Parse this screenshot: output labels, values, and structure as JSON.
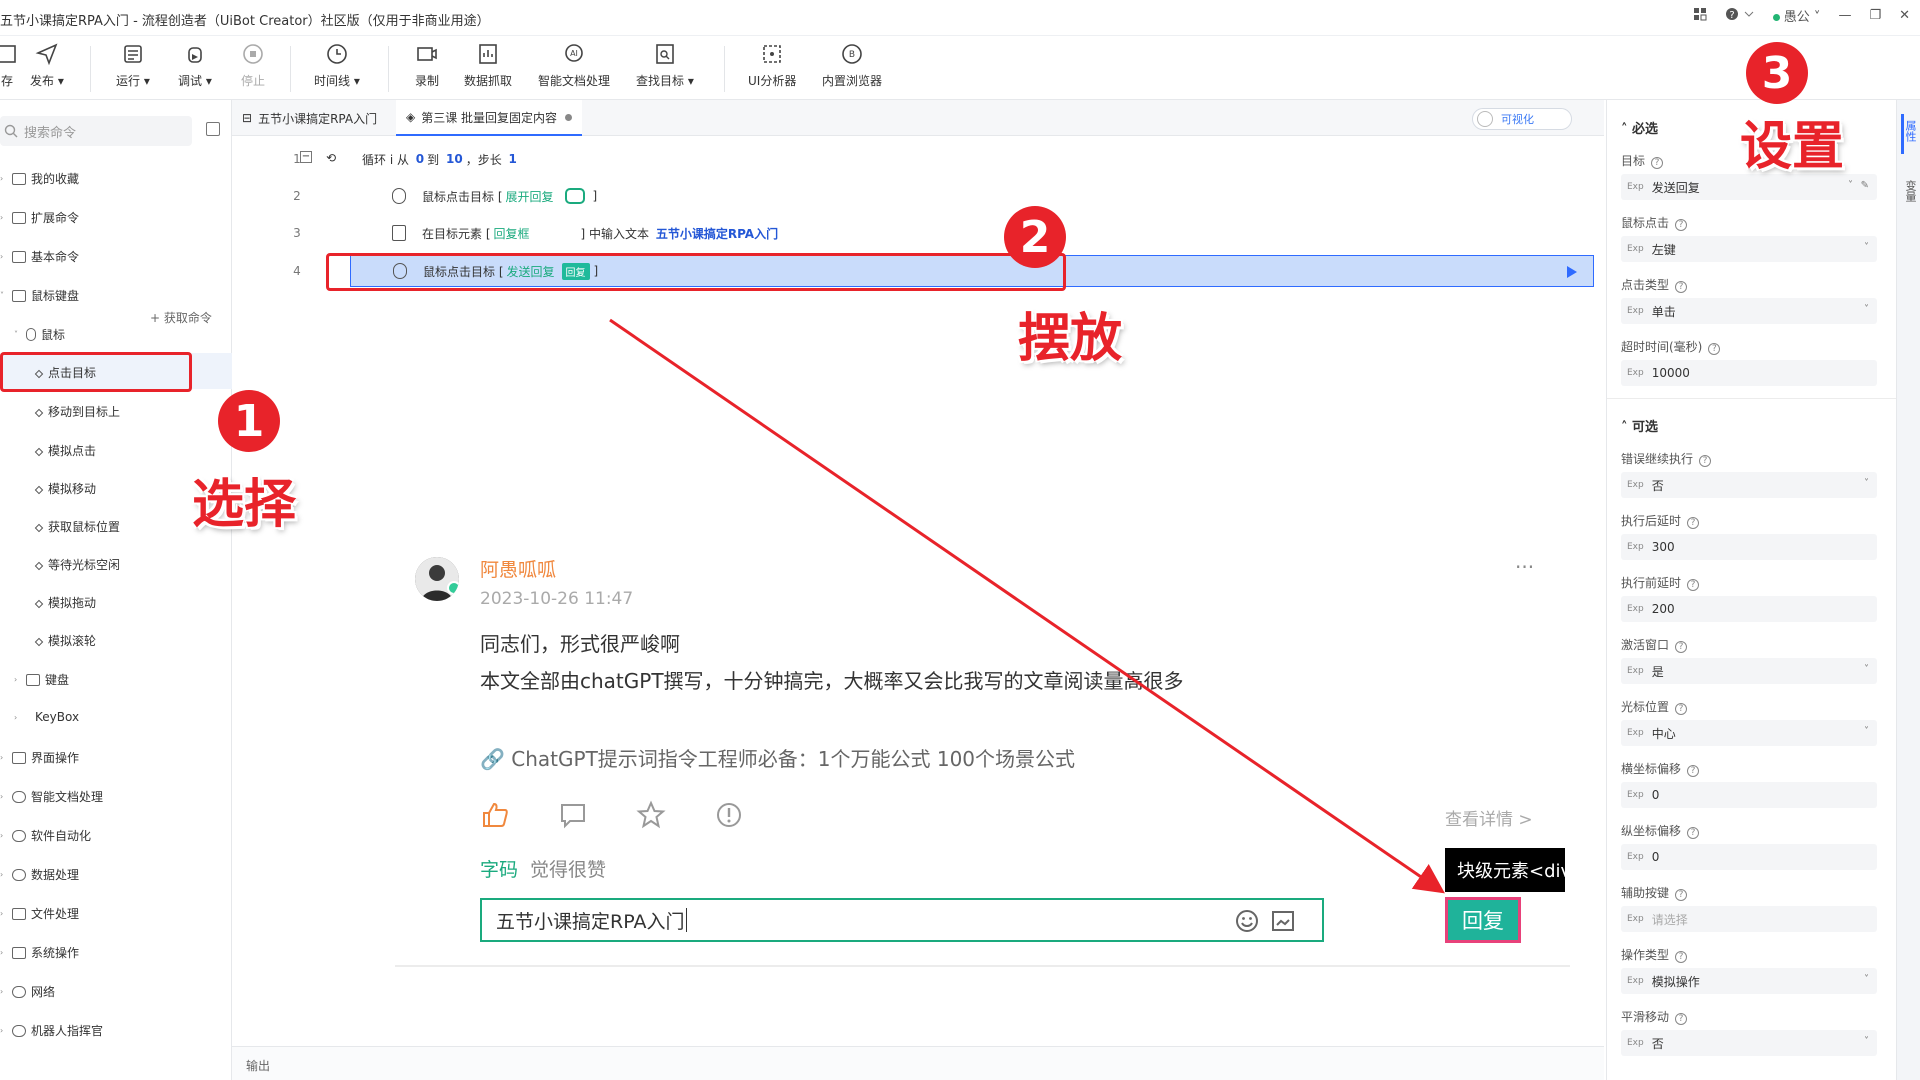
{
  "window": {
    "title": "五节小课搞定RPA入门 - 流程创造者（UiBot Creator）社区版（仅用于非商业用途）",
    "user": "愚公"
  },
  "toolbar": {
    "items": [
      {
        "label": "存"
      },
      {
        "label": "发布 ▾"
      },
      {
        "label": "运行 ▾"
      },
      {
        "label": "调试 ▾"
      },
      {
        "label": "停止"
      },
      {
        "label": "时间线 ▾"
      },
      {
        "label": "录制"
      },
      {
        "label": "数据抓取"
      },
      {
        "label": "智能文档处理"
      },
      {
        "label": "查找目标 ▾"
      },
      {
        "label": "UI分析器"
      },
      {
        "label": "内置浏览器"
      }
    ]
  },
  "left": {
    "search_placeholder": "搜索命令",
    "get_command": "获取命令",
    "tree": [
      "我的收藏",
      "扩展命令",
      "基本命令",
      "鼠标键盘",
      "鼠标"
    ],
    "mouse_items": [
      "点击目标",
      "移动到目标上",
      "模拟点击",
      "模拟移动",
      "获取鼠标位置",
      "等待光标空闲",
      "模拟拖动",
      "模拟滚轮"
    ],
    "tree2": [
      "键盘",
      "KeyBox",
      "界面操作",
      "智能文档处理",
      "软件自动化",
      "数据处理",
      "文件处理",
      "系统操作",
      "网络",
      "机器人指挥官"
    ]
  },
  "editor": {
    "tabs": [
      {
        "label": "五节小课搞定RPA入门"
      },
      {
        "label": "第三课 批量回复固定内容"
      }
    ],
    "toggle_label": "可视化",
    "lines": [
      {
        "no": "1",
        "pre": "循环 i 从",
        "a": "0",
        "mid": "到",
        "b": "10",
        "post": "，步长",
        "c": "1"
      },
      {
        "no": "2",
        "text": "鼠标点击目标 [",
        "hl": "展开回复",
        "end": "]"
      },
      {
        "no": "3",
        "text": "在目标元素 [",
        "hl": "回复框",
        "end": "] 中输入文本",
        "blue": "五节小课搞定RPA入门"
      },
      {
        "no": "4",
        "text": "鼠标点击目标 [",
        "hl": "发送回复",
        "tag": "回复",
        "end": "]"
      }
    ],
    "output": "输出"
  },
  "comment": {
    "name": "阿愚呱呱",
    "time": "2023-10-26 11:47",
    "text1": "同志们，形式很严峻啊",
    "text2": "本文全部由chatGPT撰写，十分钟搞完，大概率又会比我写的文章阅读量高很多",
    "link": "ChatGPT提示词指令工程师必备：1个万能公式 100个场景公式",
    "detail": "查看详情 >",
    "like_user": "字码",
    "like_text": "觉得很赞",
    "input_value": "五节小课搞定RPA入门",
    "reply": "回复",
    "tooltip": "块级元素<div",
    "more": "···"
  },
  "right": {
    "vtabs": [
      "属性",
      "变量"
    ],
    "required_title": "必选",
    "optional_title": "可选",
    "required": [
      {
        "label": "目标",
        "value": "发送回复",
        "kind": "target"
      },
      {
        "label": "鼠标点击",
        "value": "左键",
        "kind": "select"
      },
      {
        "label": "点击类型",
        "value": "单击",
        "kind": "select"
      },
      {
        "label": "超时时间(毫秒)",
        "value": "10000",
        "kind": "text"
      }
    ],
    "optional": [
      {
        "label": "错误继续执行",
        "value": "否",
        "kind": "select"
      },
      {
        "label": "执行后延时",
        "value": "300",
        "kind": "text"
      },
      {
        "label": "执行前延时",
        "value": "200",
        "kind": "text"
      },
      {
        "label": "激活窗口",
        "value": "是",
        "kind": "select"
      },
      {
        "label": "光标位置",
        "value": "中心",
        "kind": "select"
      },
      {
        "label": "横坐标偏移",
        "value": "0",
        "kind": "text"
      },
      {
        "label": "纵坐标偏移",
        "value": "0",
        "kind": "text"
      },
      {
        "label": "辅助按键",
        "value": "请选择",
        "kind": "ph"
      },
      {
        "label": "操作类型",
        "value": "模拟操作",
        "kind": "select"
      },
      {
        "label": "平滑移动",
        "value": "否",
        "kind": "select"
      }
    ],
    "exp": "Exp"
  },
  "annotations": {
    "step1": "1",
    "step1_text": "选择",
    "step2": "2",
    "step2_text": "摆放",
    "step3": "3",
    "step3_text": "设置",
    "color": "#e8232a"
  }
}
